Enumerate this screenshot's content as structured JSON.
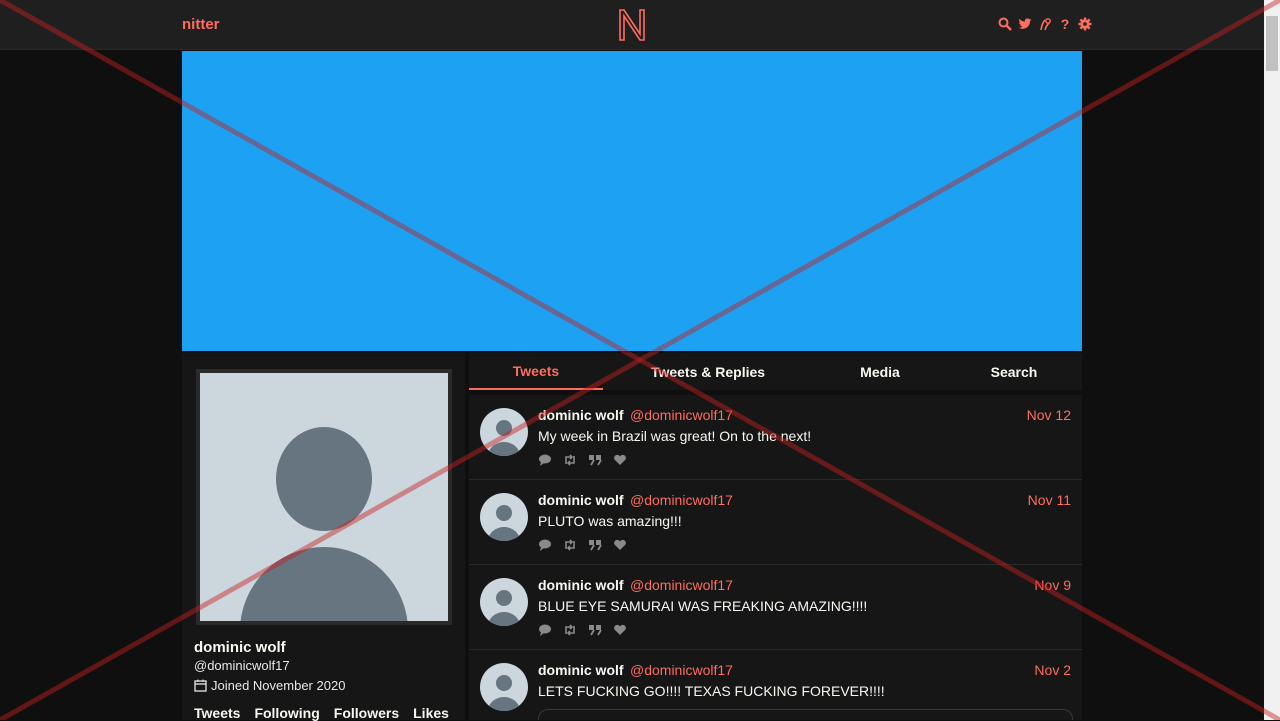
{
  "nav": {
    "brand": "nitter",
    "icons": [
      "search-icon",
      "twitter-icon",
      "rss-icon",
      "help-icon",
      "settings-icon"
    ],
    "help_label": "?"
  },
  "profile": {
    "name": "dominic wolf",
    "handle": "@dominicwolf17",
    "joined": "Joined November 2020",
    "stats": [
      "Tweets",
      "Following",
      "Followers",
      "Likes"
    ]
  },
  "tabs": [
    {
      "label": "Tweets",
      "active": true
    },
    {
      "label": "Tweets & Replies",
      "active": false
    },
    {
      "label": "Media",
      "active": false
    },
    {
      "label": "Search",
      "active": false
    }
  ],
  "tweets": [
    {
      "name": "dominic wolf",
      "handle": "@dominicwolf17",
      "date": "Nov 12",
      "text": "My week in Brazil was great! On to the next!"
    },
    {
      "name": "dominic wolf",
      "handle": "@dominicwolf17",
      "date": "Nov 11",
      "text": "PLUTO was amazing!!!"
    },
    {
      "name": "dominic wolf",
      "handle": "@dominicwolf17",
      "date": "Nov 9",
      "text": "BLUE EYE SAMURAI WAS FREAKING AMAZING!!!!"
    },
    {
      "name": "dominic wolf",
      "handle": "@dominicwolf17",
      "date": "Nov 2",
      "text": "LETS FUCKING GO!!!! TEXAS FUCKING FOREVER!!!!"
    }
  ],
  "colors": {
    "accent": "#ff6c60",
    "banner": "#1da1f2",
    "background": "#0f0f0f",
    "panel": "#161616"
  }
}
